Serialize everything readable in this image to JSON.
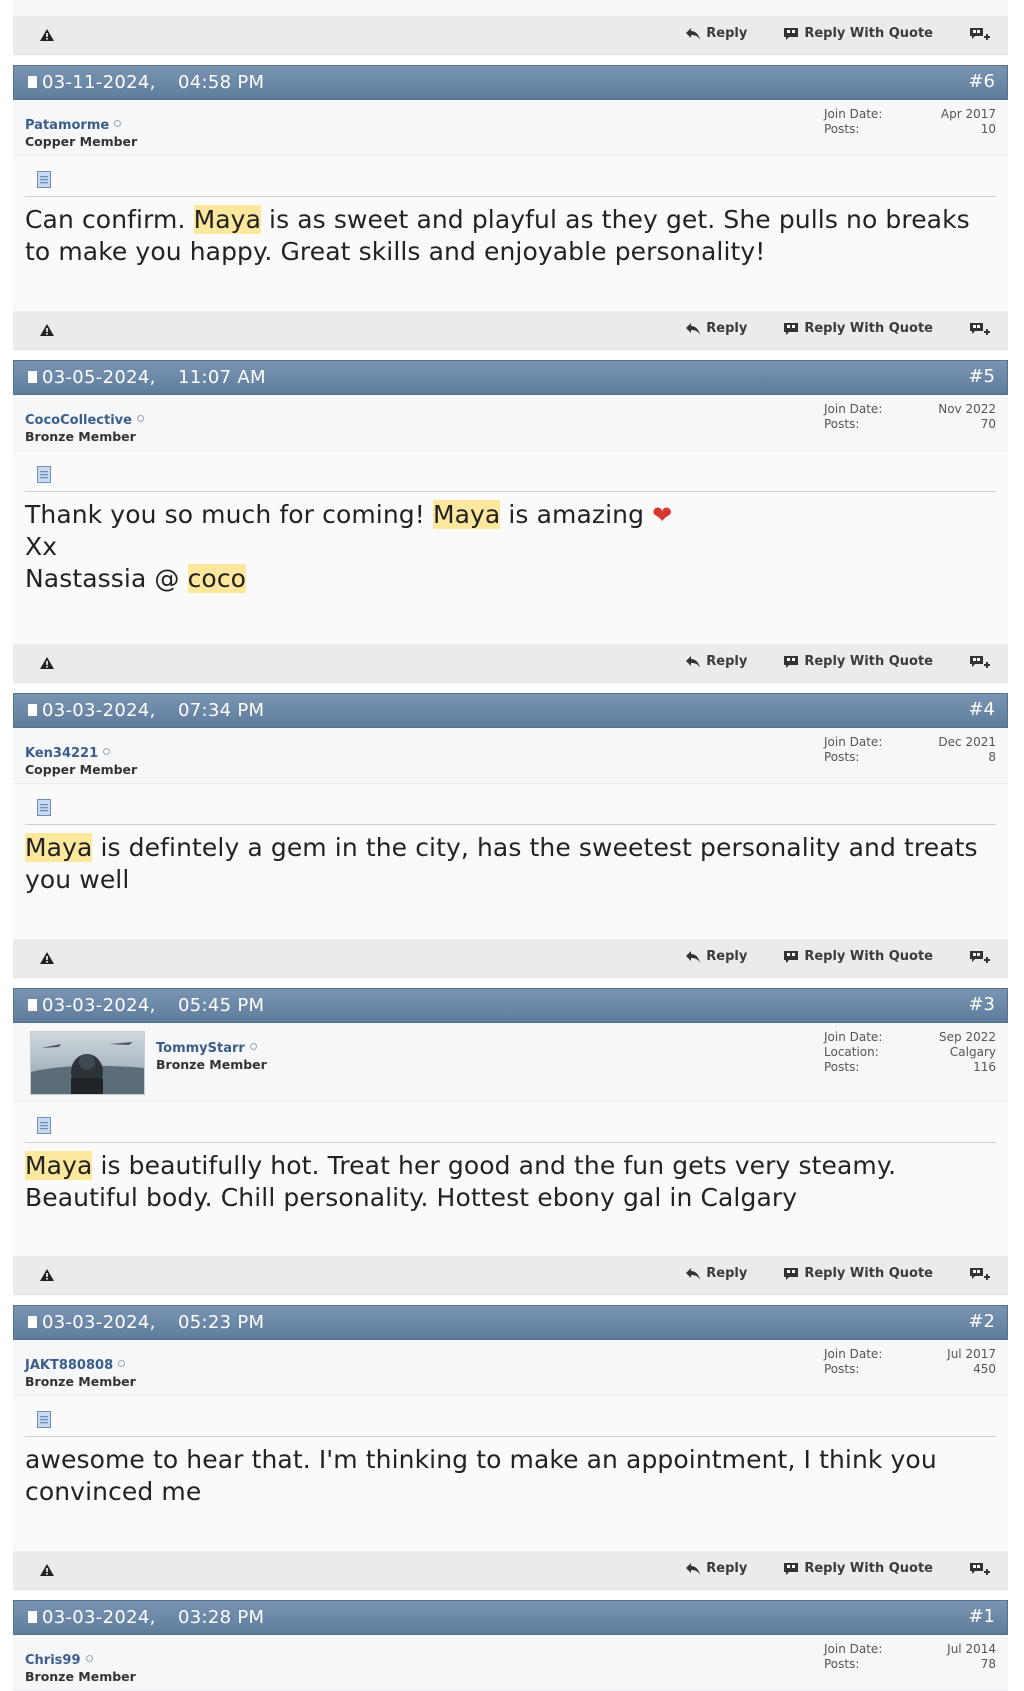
{
  "actions": {
    "reply": "Reply",
    "reply_with_quote": "Reply With Quote"
  },
  "labels": {
    "join_date": "Join Date:",
    "location": "Location:",
    "posts": "Posts:"
  },
  "colors": {
    "header_bar": "#6a87a8",
    "highlight": "#fbe89c",
    "username": "#3a5e8c"
  },
  "icons": [
    "report-icon",
    "reply-icon",
    "reply-with-quote-icon",
    "multi-quote-icon",
    "post-status-icon",
    "message-icon",
    "online-status-icon",
    "heart-icon"
  ],
  "posts": [
    {
      "date": "03-11-2024,",
      "time": "04:58 PM",
      "number": "#6",
      "username": "Patamorme",
      "rank": "Copper Member",
      "join_date": "Apr 2017",
      "posts_count": "10",
      "message": {
        "l1a": "Can confirm. ",
        "l1hl": "Maya",
        "l1b": " is as sweet and playful as they get. She pulls no breaks",
        "l2": "to make you happy. Great skills and enjoyable personality!"
      }
    },
    {
      "date": "03-05-2024,",
      "time": "11:07 AM",
      "number": "#5",
      "username": "CocoCollective",
      "rank": "Bronze Member",
      "join_date": "Nov 2022",
      "posts_count": "70",
      "message": {
        "l1a": "Thank you so much for coming! ",
        "l1hl": "Maya",
        "l1b": " is amazing ",
        "l2": "Xx",
        "l3a": "Nastassia @ ",
        "l3hl": "coco"
      }
    },
    {
      "date": "03-03-2024,",
      "time": "07:34 PM",
      "number": "#4",
      "username": "Ken34221",
      "rank": "Copper Member",
      "join_date": "Dec 2021",
      "posts_count": "8",
      "message": {
        "l1hl": "Maya",
        "l1b": " is defintely a gem in the city, has the sweetest personality and treats",
        "l2": "you well"
      }
    },
    {
      "date": "03-03-2024,",
      "time": "05:45 PM",
      "number": "#3",
      "username": "TommyStarr",
      "rank": "Bronze Member",
      "join_date": "Sep 2022",
      "location": "Calgary",
      "posts_count": "116",
      "message": {
        "l1hl": "Maya",
        "l1b": " is beautifully hot. Treat her good and the fun gets very steamy.",
        "l2": "Beautiful body. Chill personality. Hottest ebony gal in Calgary"
      }
    },
    {
      "date": "03-03-2024,",
      "time": "05:23 PM",
      "number": "#2",
      "username": "JAKT880808",
      "rank": "Bronze Member",
      "join_date": "Jul 2017",
      "posts_count": "450",
      "message": {
        "l1": "awesome to hear that. I'm thinking to make an appointment, I think you",
        "l2": "convinced me"
      }
    },
    {
      "date": "03-03-2024,",
      "time": "03:28 PM",
      "number": "#1",
      "username": "Chris99",
      "rank": "Bronze Member",
      "join_date": "Jul 2014",
      "posts_count": "78"
    }
  ]
}
